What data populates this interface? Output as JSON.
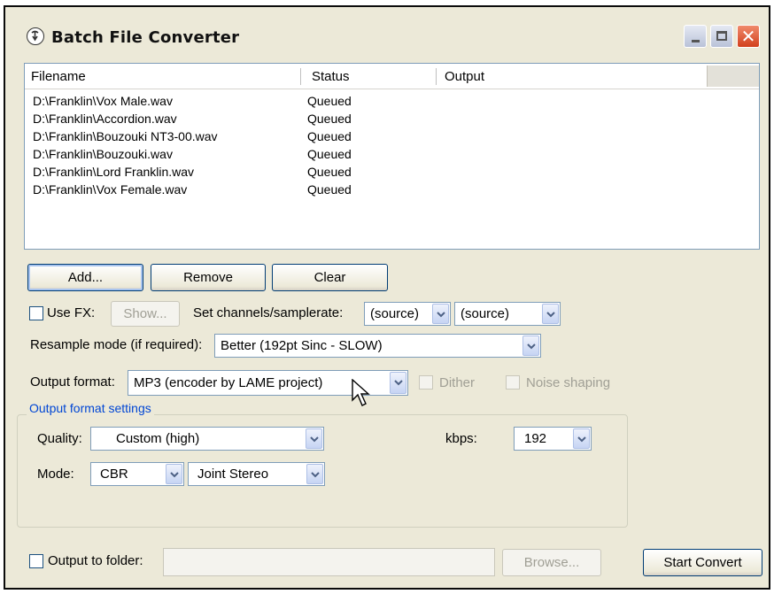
{
  "window": {
    "title": "Batch File Converter"
  },
  "file_list": {
    "columns": [
      "Filename",
      "Status",
      "Output"
    ],
    "rows": [
      {
        "filename": "D:\\Franklin\\Vox Male.wav",
        "status": "Queued",
        "output": ""
      },
      {
        "filename": "D:\\Franklin\\Accordion.wav",
        "status": "Queued",
        "output": ""
      },
      {
        "filename": "D:\\Franklin\\Bouzouki  NT3-00.wav",
        "status": "Queued",
        "output": ""
      },
      {
        "filename": "D:\\Franklin\\Bouzouki.wav",
        "status": "Queued",
        "output": ""
      },
      {
        "filename": "D:\\Franklin\\Lord Franklin.wav",
        "status": "Queued",
        "output": ""
      },
      {
        "filename": "D:\\Franklin\\Vox Female.wav",
        "status": "Queued",
        "output": ""
      }
    ]
  },
  "buttons": {
    "add": "Add...",
    "remove": "Remove",
    "clear": "Clear",
    "show": "Show...",
    "browse": "Browse...",
    "start": "Start Convert"
  },
  "fx": {
    "use_fx_label": "Use FX:",
    "use_fx_checked": false
  },
  "channels": {
    "label": "Set channels/samplerate:",
    "channels_value": "(source)",
    "samplerate_value": "(source)"
  },
  "resample": {
    "label": "Resample mode (if required):",
    "value": "Better (192pt Sinc - SLOW)"
  },
  "output_format": {
    "label": "Output format:",
    "value": "MP3 (encoder by LAME project)",
    "dither_label": "Dither",
    "noise_shaping_label": "Noise shaping"
  },
  "format_settings": {
    "title": "Output format settings",
    "quality_label": "Quality:",
    "quality_value": "Custom (high)",
    "kbps_label": "kbps:",
    "kbps_value": "192",
    "mode_label": "Mode:",
    "mode_value": "CBR",
    "stereo_value": "Joint Stereo"
  },
  "output_folder": {
    "label": "Output to folder:",
    "value": "",
    "checked": false
  },
  "colors": {
    "accent_group_title": "#0046d5",
    "window_bg": "#ece9d8",
    "close_button": "#d2401d"
  }
}
